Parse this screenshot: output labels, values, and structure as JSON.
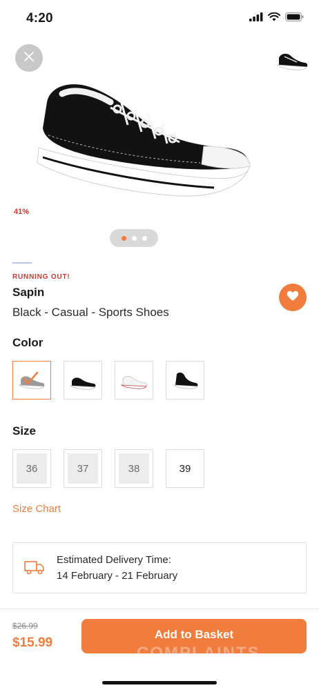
{
  "status_bar": {
    "time": "4:20",
    "icons": [
      "signal-icon",
      "wifi-icon",
      "battery-icon"
    ]
  },
  "gallery": {
    "close_icon": "close-icon",
    "discount": "41%",
    "image_count": 3,
    "active_index": 0
  },
  "product": {
    "badge": "RUNNING OUT!",
    "brand": "Sapin",
    "name": "Black - Casual - Sports Shoes",
    "favorite_icon": "heart-icon"
  },
  "color": {
    "title": "Color",
    "options": [
      {
        "name": "Grey",
        "selected": true
      },
      {
        "name": "Black Low",
        "selected": false
      },
      {
        "name": "White",
        "selected": false
      },
      {
        "name": "Black High",
        "selected": false
      }
    ]
  },
  "size": {
    "title": "Size",
    "options": [
      {
        "label": "36",
        "available": false
      },
      {
        "label": "37",
        "available": false
      },
      {
        "label": "38",
        "available": false
      },
      {
        "label": "39",
        "available": true
      }
    ],
    "chart_link": "Size Chart"
  },
  "delivery": {
    "title": "Estimated Delivery Time:",
    "dates": "14 February - 21 February",
    "icon": "truck-icon"
  },
  "purchase": {
    "old_price": "$26.99",
    "price": "$15.99",
    "button_label": "Add to Basket",
    "watermark": "COMPLAINTS"
  },
  "colors": {
    "accent": "#f07c3e",
    "alert": "#d0352b"
  }
}
